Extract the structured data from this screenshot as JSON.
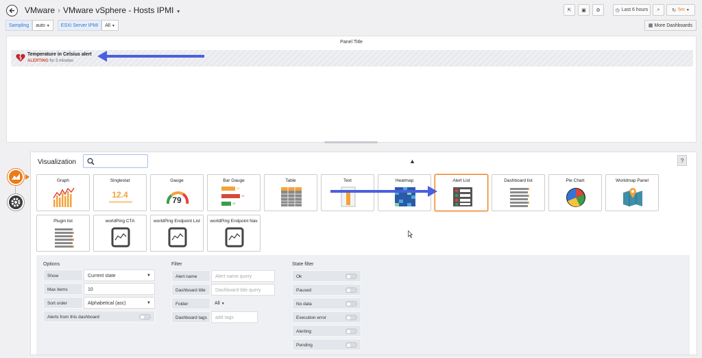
{
  "header": {
    "breadcrumb_root": "VMware",
    "breadcrumb_separator": "›",
    "dashboard_title": "VMware vSphere - Hosts IPMI",
    "time_range": "Last 6 hours",
    "refresh": "5m"
  },
  "variables": [
    {
      "label": "Sampling",
      "value": "auto"
    },
    {
      "label": "ESXi Server IPMI",
      "value": "All"
    }
  ],
  "more_dashboards": "More Dashboards",
  "panel": {
    "title": "Panel Title",
    "alert": {
      "name": "Temperature in Celsius alert",
      "state": "ALERTING",
      "duration": "for 3 minutes"
    }
  },
  "visualization": {
    "label": "Visualization",
    "help": "?",
    "tiles": [
      {
        "label": "Graph",
        "icon": "graph-icon"
      },
      {
        "label": "Singlestat",
        "icon": "singlestat-icon",
        "value": "12.4"
      },
      {
        "label": "Gauge",
        "icon": "gauge-icon",
        "value": "79"
      },
      {
        "label": "Bar Gauge",
        "icon": "bar-gauge-icon",
        "values": [
          "62",
          "76",
          "45"
        ]
      },
      {
        "label": "Table",
        "icon": "table-icon"
      },
      {
        "label": "Text",
        "icon": "text-icon"
      },
      {
        "label": "Heatmap",
        "icon": "heatmap-icon"
      },
      {
        "label": "Alert List",
        "icon": "alert-list-icon",
        "selected": true
      },
      {
        "label": "Dashboard list",
        "icon": "dashboard-list-icon"
      },
      {
        "label": "Pie Chart",
        "icon": "pie-chart-icon"
      },
      {
        "label": "Worldmap Panel",
        "icon": "worldmap-icon"
      },
      {
        "label": "Plugin list",
        "icon": "plugin-list-icon"
      },
      {
        "label": "worldPing CTA",
        "icon": "worldping-icon"
      },
      {
        "label": "worldPing Endpoint List",
        "icon": "worldping-icon"
      },
      {
        "label": "worldPing Endpoint Nav",
        "icon": "worldping-icon"
      }
    ]
  },
  "options": {
    "title": "Options",
    "show_label": "Show",
    "show_value": "Current state",
    "max_label": "Max items",
    "max_value": "10",
    "sort_label": "Sort order",
    "sort_value": "Alphabetical (asc)",
    "from_dash_label": "Alerts from this dashboard"
  },
  "filter": {
    "title": "Filter",
    "name_label": "Alert name",
    "name_placeholder": "Alert name query",
    "dtitle_label": "Dashboard title",
    "dtitle_placeholder": "Dashboard title query",
    "folder_label": "Folder",
    "folder_value": "All",
    "tags_label": "Dashboard tags",
    "tags_placeholder": "add tags"
  },
  "state_filter": {
    "title": "State filter",
    "items": [
      "Ok",
      "Paused",
      "No data",
      "Execution error",
      "Alerting",
      "Pending"
    ]
  },
  "colors": {
    "accent": "#eb7b18",
    "alert": "#d44a3a",
    "arrow": "#4a5fe0",
    "link": "#3274d9"
  }
}
